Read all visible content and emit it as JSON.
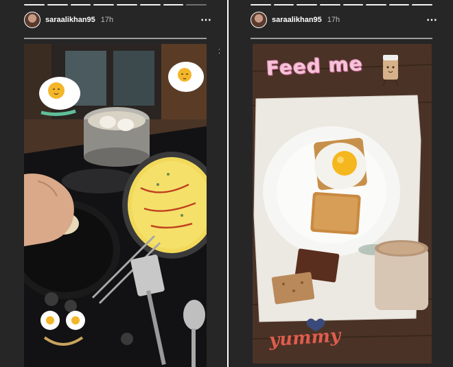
{
  "stories": [
    {
      "username": "saraalikhan95",
      "timestamp": "17h",
      "more_icon": "⋯",
      "progress_segments": 8,
      "progress_done": 7
    },
    {
      "username": "saraalikhan95",
      "timestamp": "17h",
      "more_icon": "⋯",
      "progress_segments": 8,
      "progress_done": 8,
      "overlay_top": "Feed me",
      "overlay_bottom": "yummy"
    }
  ],
  "icons": [
    "more-options-icon",
    "egg-sticker-icon",
    "coffee-cup-sticker-icon",
    "heart-sticker-icon"
  ],
  "colors": {
    "panel_bg": "#262626",
    "feed_me_pink": "#f4c4d8",
    "yummy_red": "#e05c4e"
  }
}
